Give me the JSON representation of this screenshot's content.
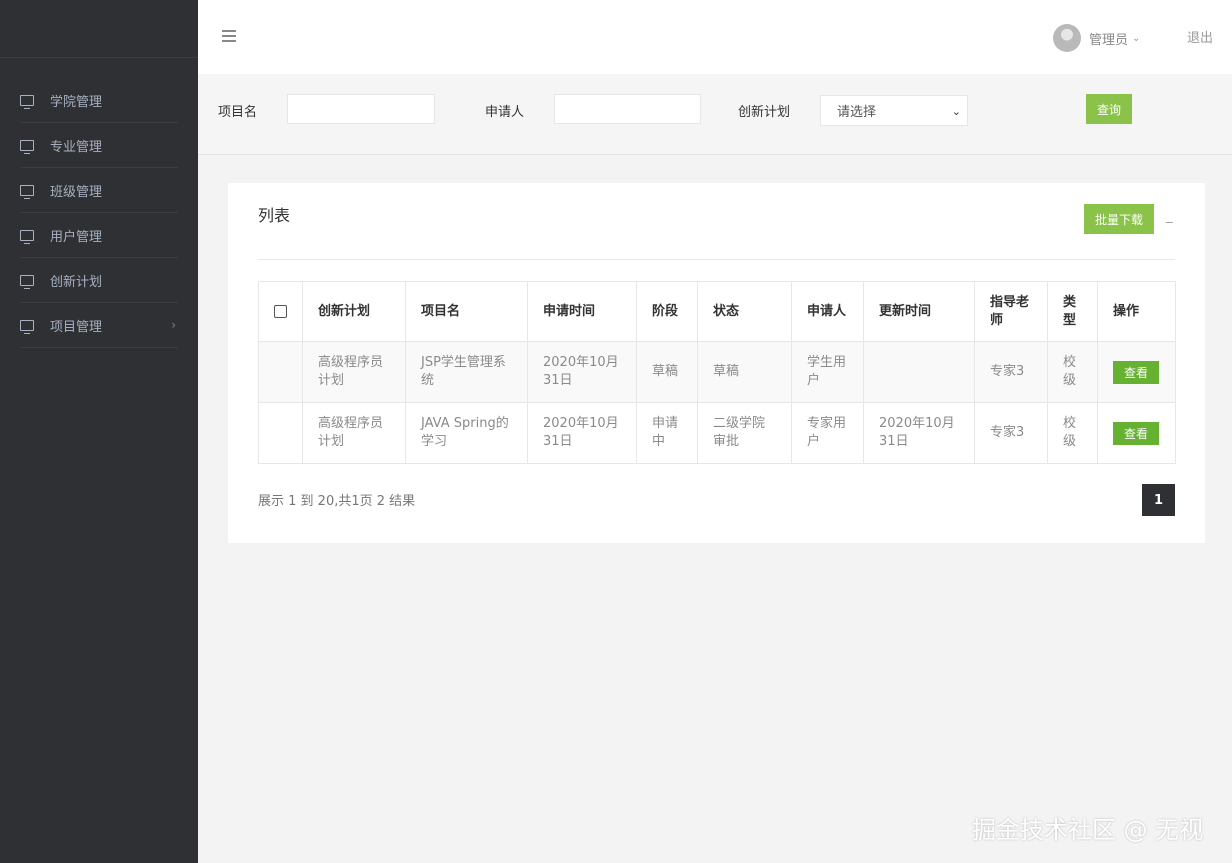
{
  "sidebar": {
    "items": [
      {
        "label": "学院管理"
      },
      {
        "label": "专业管理"
      },
      {
        "label": "班级管理"
      },
      {
        "label": "用户管理"
      },
      {
        "label": "创新计划"
      },
      {
        "label": "项目管理",
        "arrow": "›"
      }
    ]
  },
  "header": {
    "user_name": "管理员",
    "logout": "退出"
  },
  "search": {
    "project_label": "项目名",
    "applicant_label": "申请人",
    "plan_label": "创新计划",
    "plan_select_value": "请选择",
    "query_button": "查询"
  },
  "card": {
    "title": "列表",
    "batch_download": "批量下载",
    "collapse": "_"
  },
  "table": {
    "columns": [
      "创新计划",
      "项目名",
      "申请时间",
      "阶段",
      "状态",
      "申请人",
      "更新时间",
      "指导老师",
      "类型",
      "操作"
    ],
    "rows": [
      {
        "plan": "高级程序员计划",
        "project": "JSP学生管理系统",
        "apply_time": "2020年10月31日",
        "stage": "草稿",
        "status": "草稿",
        "applicant": "学生用户",
        "update_time": "",
        "teacher": "专家3",
        "type": "校级",
        "action": "查看"
      },
      {
        "plan": "高级程序员计划",
        "project": "JAVA Spring的学习",
        "apply_time": "2020年10月31日",
        "stage": "申请中",
        "status": "二级学院审批",
        "applicant": "专家用户",
        "update_time": "2020年10月31日",
        "teacher": "专家3",
        "type": "校级",
        "action": "查看"
      }
    ]
  },
  "pager": {
    "info": "展示 1 到 20,共1页 2 结果",
    "current_page": "1"
  },
  "watermark": "掘金技术社区 @ 无视",
  "colors": {
    "sidebar_bg": "#2f3033",
    "accent_green": "#8bc34a",
    "view_button_green": "#66b032"
  }
}
